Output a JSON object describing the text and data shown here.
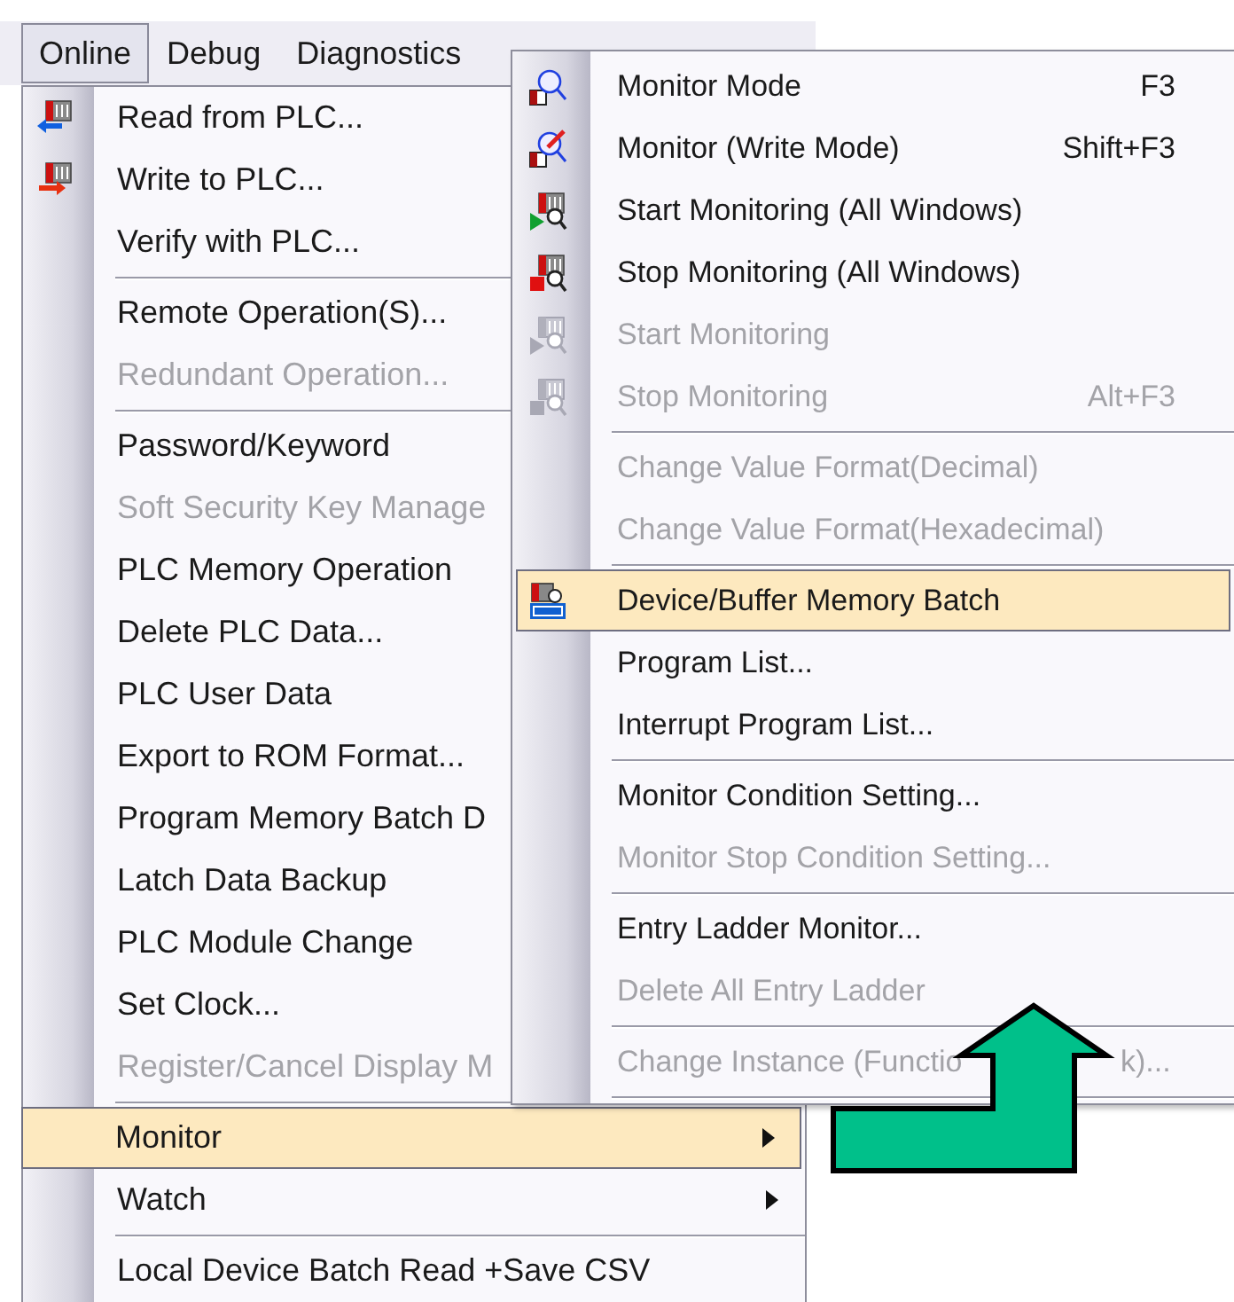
{
  "menubar": [
    {
      "label": "Online",
      "selected": true
    },
    {
      "label": "Debug",
      "selected": false
    },
    {
      "label": "Diagnostics",
      "selected": false
    }
  ],
  "main_menu": [
    {
      "kind": "item",
      "label": "Read from PLC...",
      "disabled": false,
      "selected": false
    },
    {
      "kind": "item",
      "label": "Write to PLC...",
      "disabled": false,
      "selected": false
    },
    {
      "kind": "item",
      "label": "Verify with PLC...",
      "disabled": false,
      "selected": false
    },
    {
      "kind": "separator"
    },
    {
      "kind": "item",
      "label": "Remote Operation(S)...",
      "disabled": false,
      "selected": false
    },
    {
      "kind": "item",
      "label": "Redundant Operation...",
      "disabled": true,
      "selected": false
    },
    {
      "kind": "separator"
    },
    {
      "kind": "item",
      "label": "Password/Keyword",
      "disabled": false,
      "selected": false
    },
    {
      "kind": "item",
      "label": "Soft Security Key Manage",
      "disabled": true,
      "selected": false
    },
    {
      "kind": "item",
      "label": "PLC Memory Operation",
      "disabled": false,
      "selected": false
    },
    {
      "kind": "item",
      "label": "Delete PLC Data...",
      "disabled": false,
      "selected": false
    },
    {
      "kind": "item",
      "label": "PLC User Data",
      "disabled": false,
      "selected": false
    },
    {
      "kind": "item",
      "label": "Export to ROM Format...",
      "disabled": false,
      "selected": false
    },
    {
      "kind": "item",
      "label": "Program Memory Batch D",
      "disabled": false,
      "selected": false
    },
    {
      "kind": "item",
      "label": "Latch Data Backup",
      "disabled": false,
      "selected": false
    },
    {
      "kind": "item",
      "label": "PLC Module Change",
      "disabled": false,
      "selected": false
    },
    {
      "kind": "item",
      "label": "Set Clock...",
      "disabled": false,
      "selected": false
    },
    {
      "kind": "item",
      "label": "Register/Cancel Display M",
      "disabled": true,
      "selected": false
    },
    {
      "kind": "separator"
    },
    {
      "kind": "item",
      "label": "Monitor",
      "disabled": false,
      "selected": true,
      "submenu": true
    },
    {
      "kind": "item",
      "label": "Watch",
      "disabled": false,
      "selected": false,
      "submenu": true
    },
    {
      "kind": "separator"
    },
    {
      "kind": "item",
      "label": "Local Device Batch Read +Save CSV",
      "disabled": false,
      "selected": false
    }
  ],
  "monitor_submenu": [
    {
      "kind": "item",
      "label": "Monitor Mode",
      "shortcut": "F3",
      "disabled": false,
      "selected": false
    },
    {
      "kind": "item",
      "label": "Monitor (Write Mode)",
      "shortcut": "Shift+F3",
      "disabled": false,
      "selected": false
    },
    {
      "kind": "item",
      "label": "Start Monitoring (All Windows)",
      "disabled": false,
      "selected": false
    },
    {
      "kind": "item",
      "label": "Stop Monitoring (All Windows)",
      "disabled": false,
      "selected": false
    },
    {
      "kind": "item",
      "label": "Start Monitoring",
      "disabled": true,
      "selected": false
    },
    {
      "kind": "item",
      "label": "Stop Monitoring",
      "shortcut": "Alt+F3",
      "disabled": true,
      "selected": false
    },
    {
      "kind": "separator"
    },
    {
      "kind": "item",
      "label": "Change Value Format(Decimal)",
      "disabled": true,
      "selected": false
    },
    {
      "kind": "item",
      "label": "Change Value Format(Hexadecimal)",
      "disabled": true,
      "selected": false
    },
    {
      "kind": "separator"
    },
    {
      "kind": "item",
      "label": "Device/Buffer Memory Batch",
      "disabled": false,
      "selected": true
    },
    {
      "kind": "item",
      "label": "Program List...",
      "disabled": false,
      "selected": false
    },
    {
      "kind": "item",
      "label": "Interrupt Program List...",
      "disabled": false,
      "selected": false
    },
    {
      "kind": "separator"
    },
    {
      "kind": "item",
      "label": "Monitor Condition Setting...",
      "disabled": false,
      "selected": false
    },
    {
      "kind": "item",
      "label": "Monitor Stop Condition Setting...",
      "disabled": true,
      "selected": false
    },
    {
      "kind": "separator"
    },
    {
      "kind": "item",
      "label": "Entry Ladder Monitor...",
      "disabled": false,
      "selected": false
    },
    {
      "kind": "item",
      "label": "Delete All Entry Ladder",
      "disabled": true,
      "selected": false
    },
    {
      "kind": "separator"
    },
    {
      "kind": "item",
      "label": "Change Instance (Functio",
      "label_end": "k)...",
      "disabled": true,
      "selected": false
    },
    {
      "kind": "separator"
    }
  ]
}
